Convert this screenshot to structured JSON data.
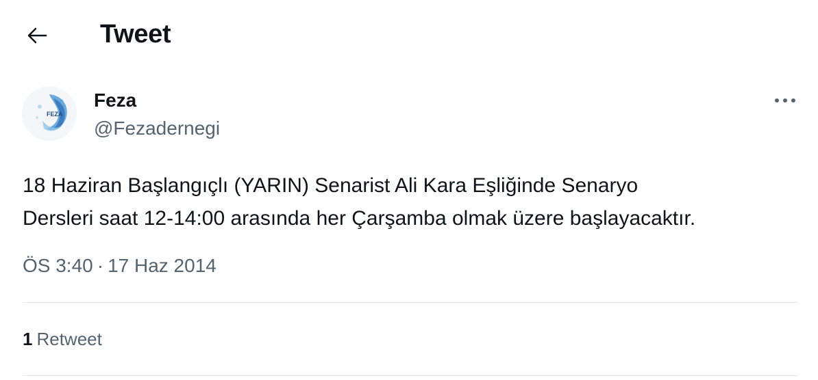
{
  "header": {
    "title": "Tweet",
    "back_icon": "arrow-left-icon"
  },
  "author": {
    "display_name": "Feza",
    "handle": "@Fezadernegi",
    "avatar_text": "FEZA"
  },
  "tweet": {
    "text_lines": [
      "18 Haziran Başlangıçlı (YARIN) Senarist Ali Kara Eşliğinde Senaryo",
      "Dersleri saat 12-14:00 arasında her Çarşamba olmak üzere başlayacaktır."
    ],
    "time": "ÖS 3:40",
    "separator": "·",
    "date": "17 Haz 2014"
  },
  "stats": {
    "retweet_count": "1",
    "retweet_label": "Retweet"
  },
  "colors": {
    "text_primary": "#0f1419",
    "text_secondary": "#536471",
    "divider": "#e6e9ec",
    "avatar_accent": "#2b7fc4"
  },
  "icons": {
    "more": "more-horizontal-icon"
  }
}
